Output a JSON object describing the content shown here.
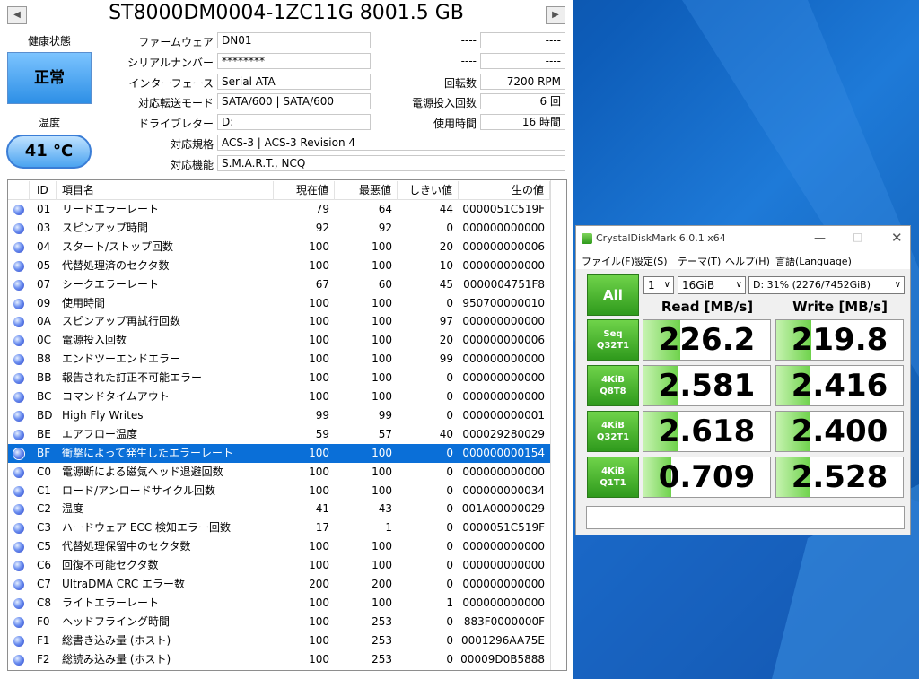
{
  "cdi": {
    "title": "ST8000DM0004-1ZC11G 8001.5 GB",
    "health_label": "健康状態",
    "health_value": "正常",
    "temp_label": "温度",
    "temp_value": "41 °C",
    "fields": {
      "firmware": {
        "label": "ファームウェア",
        "value": "DN01"
      },
      "serial": {
        "label": "シリアルナンバー",
        "value": "********"
      },
      "interface": {
        "label": "インターフェース",
        "value": "Serial ATA"
      },
      "transfer": {
        "label": "対応転送モード",
        "value": "SATA/600 | SATA/600"
      },
      "drive": {
        "label": "ドライブレター",
        "value": "D:"
      },
      "standard": {
        "label": "対応規格",
        "value": "ACS-3 | ACS-3 Revision 4"
      },
      "features": {
        "label": "対応機能",
        "value": "S.M.A.R.T., NCQ"
      }
    },
    "right_fields": {
      "blank1": {
        "label": "----",
        "value": "----"
      },
      "blank2": {
        "label": "----",
        "value": "----"
      },
      "rpm": {
        "label": "回転数",
        "value": "7200 RPM"
      },
      "power_count": {
        "label": "電源投入回数",
        "value": "6 回"
      },
      "power_hours": {
        "label": "使用時間",
        "value": "16 時間"
      }
    },
    "nav_prev": "◀",
    "nav_next": "▶",
    "smart_headers": [
      "ID",
      "項目名",
      "現在値",
      "最悪値",
      "しきい値",
      "生の値"
    ],
    "smart_rows": [
      [
        "01",
        "リードエラーレート",
        "79",
        "64",
        "44",
        "0000051C519F"
      ],
      [
        "03",
        "スピンアップ時間",
        "92",
        "92",
        "0",
        "000000000000"
      ],
      [
        "04",
        "スタート/ストップ回数",
        "100",
        "100",
        "20",
        "000000000006"
      ],
      [
        "05",
        "代替処理済のセクタ数",
        "100",
        "100",
        "10",
        "000000000000"
      ],
      [
        "07",
        "シークエラーレート",
        "67",
        "60",
        "45",
        "0000004751F8"
      ],
      [
        "09",
        "使用時間",
        "100",
        "100",
        "0",
        "950700000010"
      ],
      [
        "0A",
        "スピンアップ再試行回数",
        "100",
        "100",
        "97",
        "000000000000"
      ],
      [
        "0C",
        "電源投入回数",
        "100",
        "100",
        "20",
        "000000000006"
      ],
      [
        "B8",
        "エンドツーエンドエラー",
        "100",
        "100",
        "99",
        "000000000000"
      ],
      [
        "BB",
        "報告された訂正不可能エラー",
        "100",
        "100",
        "0",
        "000000000000"
      ],
      [
        "BC",
        "コマンドタイムアウト",
        "100",
        "100",
        "0",
        "000000000000"
      ],
      [
        "BD",
        "High Fly Writes",
        "99",
        "99",
        "0",
        "000000000001"
      ],
      [
        "BE",
        "エアフロー温度",
        "59",
        "57",
        "40",
        "000029280029"
      ],
      [
        "BF",
        "衝撃によって発生したエラーレート",
        "100",
        "100",
        "0",
        "000000000154"
      ],
      [
        "C0",
        "電源断による磁気ヘッド退避回数",
        "100",
        "100",
        "0",
        "000000000000"
      ],
      [
        "C1",
        "ロード/アンロードサイクル回数",
        "100",
        "100",
        "0",
        "000000000034"
      ],
      [
        "C2",
        "温度",
        "41",
        "43",
        "0",
        "001A00000029"
      ],
      [
        "C3",
        "ハードウェア ECC 検知エラー回数",
        "17",
        "1",
        "0",
        "0000051C519F"
      ],
      [
        "C5",
        "代替処理保留中のセクタ数",
        "100",
        "100",
        "0",
        "000000000000"
      ],
      [
        "C6",
        "回復不可能セクタ数",
        "100",
        "100",
        "0",
        "000000000000"
      ],
      [
        "C7",
        "UltraDMA CRC エラー数",
        "200",
        "200",
        "0",
        "000000000000"
      ],
      [
        "C8",
        "ライトエラーレート",
        "100",
        "100",
        "1",
        "000000000000"
      ],
      [
        "F0",
        "ヘッドフライング時間",
        "100",
        "253",
        "0",
        "883F0000000F"
      ],
      [
        "F1",
        "総書き込み量 (ホスト)",
        "100",
        "253",
        "0",
        "0001296AA75E"
      ],
      [
        "F2",
        "総読み込み量 (ホスト)",
        "100",
        "253",
        "0",
        "00009D0B5888"
      ]
    ],
    "selected_row": 13
  },
  "cdm": {
    "window_title": "CrystalDiskMark 6.0.1 x64",
    "menu": [
      "ファイル(F)",
      "設定(S)",
      "テーマ(T)",
      "ヘルプ(H)",
      "言語(Language)"
    ],
    "all_button": "All",
    "count_select": "1",
    "size_select": "16GiB",
    "drive_select": "D: 31% (2276/7452GiB)",
    "read_header": "Read [MB/s]",
    "write_header": "Write [MB/s]",
    "tests": [
      {
        "line1": "Seq",
        "line2": "Q32T1",
        "read": "226.2",
        "write": "219.8",
        "read_fill": 0.29,
        "write_fill": 0.28
      },
      {
        "line1": "4KiB",
        "line2": "Q8T8",
        "read": "2.581",
        "write": "2.416",
        "read_fill": 0.27,
        "write_fill": 0.27
      },
      {
        "line1": "4KiB",
        "line2": "Q32T1",
        "read": "2.618",
        "write": "2.400",
        "read_fill": 0.27,
        "write_fill": 0.27
      },
      {
        "line1": "4KiB",
        "line2": "Q1T1",
        "read": "0.709",
        "write": "2.528",
        "read_fill": 0.22,
        "write_fill": 0.27
      }
    ],
    "status_text": "",
    "accent": "#3fae26"
  }
}
